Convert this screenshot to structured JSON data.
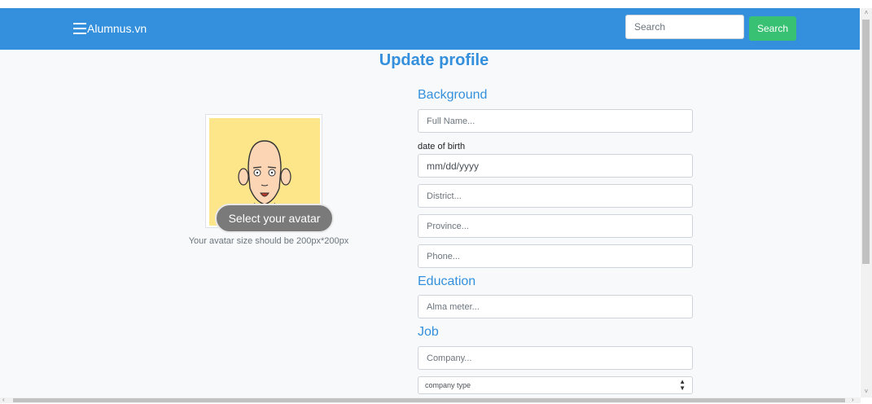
{
  "navbar": {
    "brand": "Alumnus.vn",
    "search_placeholder": "Search",
    "search_button": "Search",
    "color": "#3490dc",
    "search_button_color": "#38c172"
  },
  "page": {
    "title": "Update profile"
  },
  "avatar": {
    "button_label": "Select your avatar",
    "hint": "Your avatar size should be 200px*200px"
  },
  "form": {
    "background_heading": "Background",
    "full_name_placeholder": "Full Name...",
    "dob_label": "date of birth",
    "dob_value": "mm/dd/yyyy",
    "district_placeholder": "District...",
    "province_placeholder": "Province...",
    "phone_placeholder": "Phone...",
    "education_heading": "Education",
    "alma_meter_placeholder": "Alma meter...",
    "job_heading": "Job",
    "company_placeholder": "Company...",
    "company_type_selected": "company type"
  },
  "icons": {
    "menu": "hamburger-icon",
    "select_caret": "up-down-caret-icon"
  }
}
